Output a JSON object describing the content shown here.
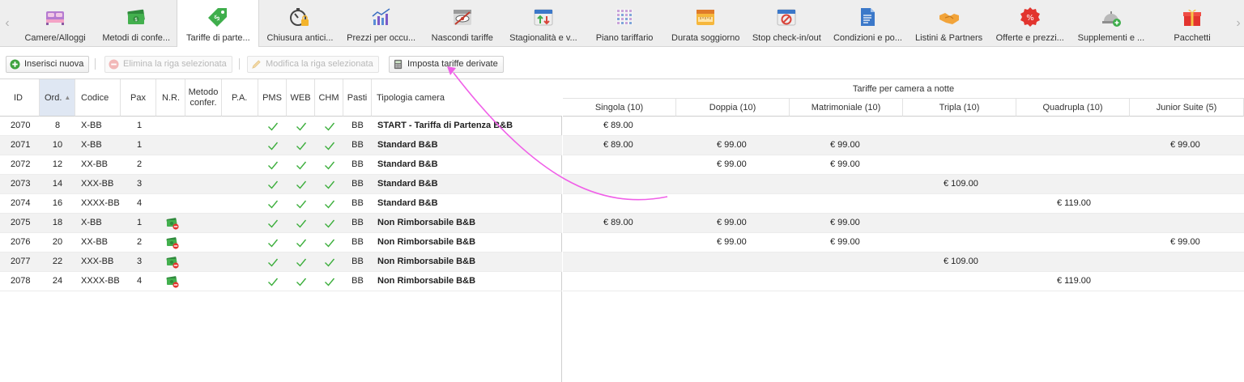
{
  "nav": {
    "prev_glyph": "‹",
    "next_glyph": "›",
    "tabs": [
      {
        "label": "Camere/Alloggi",
        "icon": "bed-icon"
      },
      {
        "label": "Metodi di confe...",
        "icon": "money-icon"
      },
      {
        "label": "Tariffe di parte...",
        "icon": "price-tag-icon",
        "active": true
      },
      {
        "label": "Chiusura antici...",
        "icon": "stopwatch-lock-icon"
      },
      {
        "label": "Prezzi per occu...",
        "icon": "bar-chart-icon"
      },
      {
        "label": "Nascondi tariffe",
        "icon": "hidden-calendar-icon"
      },
      {
        "label": "Stagionalità e v...",
        "icon": "calendar-arrows-icon"
      },
      {
        "label": "Piano tariffario",
        "icon": "grid-plan-icon"
      },
      {
        "label": "Durata soggiorno",
        "icon": "ruler-calendar-icon"
      },
      {
        "label": "Stop check-in/out",
        "icon": "stop-calendar-icon"
      },
      {
        "label": "Condizioni e po...",
        "icon": "document-icon"
      },
      {
        "label": "Listini & Partners",
        "icon": "handshake-icon"
      },
      {
        "label": "Offerte e prezzi...",
        "icon": "percent-badge-icon"
      },
      {
        "label": "Supplementi e ...",
        "icon": "service-bell-icon"
      },
      {
        "label": "Pacchetti",
        "icon": "gift-icon"
      }
    ]
  },
  "toolbar": {
    "add_label": "Inserisci nuova",
    "delete_label": "Elimina la riga selezionata",
    "edit_label": "Modifica la riga selezionata",
    "derived_label": "Imposta tariffe derivate"
  },
  "left_headers": {
    "id": "ID",
    "ord": "Ord.",
    "code": "Codice",
    "pax": "Pax",
    "nr": "N.R.",
    "method_line1": "Metodo",
    "method_line2": "confer.",
    "pa": "P.A.",
    "pms": "PMS",
    "web": "WEB",
    "chm": "CHM",
    "meals": "Pasti",
    "room_type": "Tipologia camera"
  },
  "right_header": {
    "group_title": "Tariffe per camera a notte",
    "columns": [
      "Singola (10)",
      "Doppia (10)",
      "Matrimoniale (10)",
      "Tripla (10)",
      "Quadrupla (10)",
      "Junior Suite (5)"
    ]
  },
  "rows": [
    {
      "id": "2070",
      "ord": "8",
      "code": "X-BB",
      "pax": "1",
      "nr": false,
      "meals": "BB",
      "name": "START - Tariffa di Partenza B&B",
      "prices": [
        "€ 89.00",
        "",
        "",
        "",
        "",
        ""
      ]
    },
    {
      "id": "2071",
      "ord": "10",
      "code": "X-BB",
      "pax": "1",
      "nr": false,
      "meals": "BB",
      "name": "Standard B&B",
      "prices": [
        "€ 89.00",
        "€ 99.00",
        "€ 99.00",
        "",
        "",
        "€ 99.00"
      ]
    },
    {
      "id": "2072",
      "ord": "12",
      "code": "XX-BB",
      "pax": "2",
      "nr": false,
      "meals": "BB",
      "name": "Standard B&B",
      "prices": [
        "",
        "€ 99.00",
        "€ 99.00",
        "",
        "",
        ""
      ]
    },
    {
      "id": "2073",
      "ord": "14",
      "code": "XXX-BB",
      "pax": "3",
      "nr": false,
      "meals": "BB",
      "name": "Standard B&B",
      "prices": [
        "",
        "",
        "",
        "€ 109.00",
        "",
        ""
      ]
    },
    {
      "id": "2074",
      "ord": "16",
      "code": "XXXX-BB",
      "pax": "4",
      "nr": false,
      "meals": "BB",
      "name": "Standard B&B",
      "prices": [
        "",
        "",
        "",
        "",
        "€ 119.00",
        ""
      ]
    },
    {
      "id": "2075",
      "ord": "18",
      "code": "X-BB",
      "pax": "1",
      "nr": true,
      "meals": "BB",
      "name": "Non Rimborsabile B&B",
      "prices": [
        "€ 89.00",
        "€ 99.00",
        "€ 99.00",
        "",
        "",
        ""
      ]
    },
    {
      "id": "2076",
      "ord": "20",
      "code": "XX-BB",
      "pax": "2",
      "nr": true,
      "meals": "BB",
      "name": "Non Rimborsabile B&B",
      "prices": [
        "",
        "€ 99.00",
        "€ 99.00",
        "",
        "",
        "€ 99.00"
      ]
    },
    {
      "id": "2077",
      "ord": "22",
      "code": "XXX-BB",
      "pax": "3",
      "nr": true,
      "meals": "BB",
      "name": "Non Rimborsabile B&B",
      "prices": [
        "",
        "",
        "",
        "€ 109.00",
        "",
        ""
      ]
    },
    {
      "id": "2078",
      "ord": "24",
      "code": "XXXX-BB",
      "pax": "4",
      "nr": true,
      "meals": "BB",
      "name": "Non Rimborsabile B&B",
      "prices": [
        "",
        "",
        "",
        "",
        "€ 119.00",
        ""
      ]
    }
  ],
  "colors": {
    "check": "#3cae3c",
    "arrow": "#f060e8",
    "sorted_header": "#dfe7f3"
  }
}
